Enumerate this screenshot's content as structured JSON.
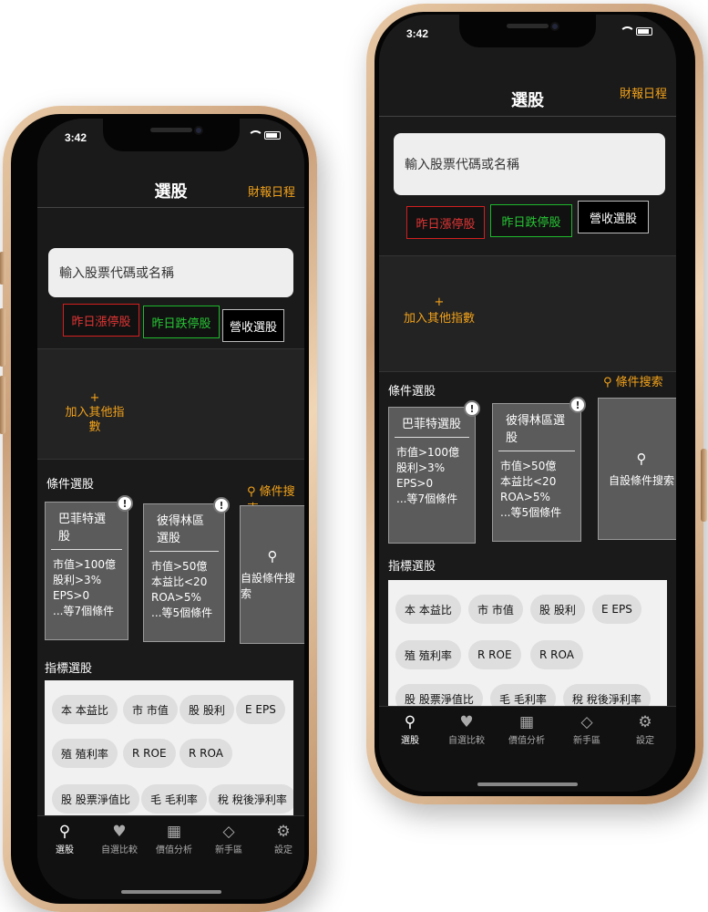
{
  "status": {
    "time": "3:42"
  },
  "header": {
    "title": "選股",
    "calendar_link": "財報日程"
  },
  "search": {
    "placeholder": "輸入股票代碼或名稱"
  },
  "quick_buttons": {
    "limit_up": "昨日漲停股",
    "limit_down": "昨日跌停股",
    "revenue": "營收選股"
  },
  "add_index": {
    "plus": "+",
    "label": "加入其他指數"
  },
  "condition_section": {
    "title": "條件選股",
    "search_link": "條件搜索"
  },
  "cards": [
    {
      "title": "巴菲特選股",
      "lines": [
        "市值>100億",
        "股利>3%",
        "EPS>0",
        "...等7個條件"
      ],
      "badge": "!"
    },
    {
      "title": "彼得林區選股",
      "lines": [
        "市值>50億",
        "本益比<20",
        "ROA>5%",
        "...等5個條件"
      ],
      "badge": "!"
    },
    {
      "title": "自設條件搜索"
    }
  ],
  "indicator_section": {
    "title": "指標選股"
  },
  "chips": [
    {
      "icon": "本",
      "label": "本益比"
    },
    {
      "icon": "市",
      "label": "市值"
    },
    {
      "icon": "股",
      "label": "股利"
    },
    {
      "icon": "E",
      "label": "EPS"
    },
    {
      "icon": "殖",
      "label": "殖利率"
    },
    {
      "icon": "R",
      "label": "ROE"
    },
    {
      "icon": "R",
      "label": "ROA"
    },
    {
      "icon": "股",
      "label": "股票淨值比"
    },
    {
      "icon": "毛",
      "label": "毛利率"
    },
    {
      "icon": "稅",
      "label": "稅後淨利率"
    }
  ],
  "tabs": [
    {
      "icon": "search-icon",
      "label": "選股"
    },
    {
      "icon": "heart-icon",
      "label": "自選比較"
    },
    {
      "icon": "calculator-icon",
      "label": "價值分析"
    },
    {
      "icon": "diamond-icon",
      "label": "新手區"
    },
    {
      "icon": "gear-icon",
      "label": "設定"
    }
  ],
  "colors": {
    "accent": "#f2a21a",
    "up": "#e23535",
    "down": "#27c635",
    "frame": "#d9b48f"
  }
}
